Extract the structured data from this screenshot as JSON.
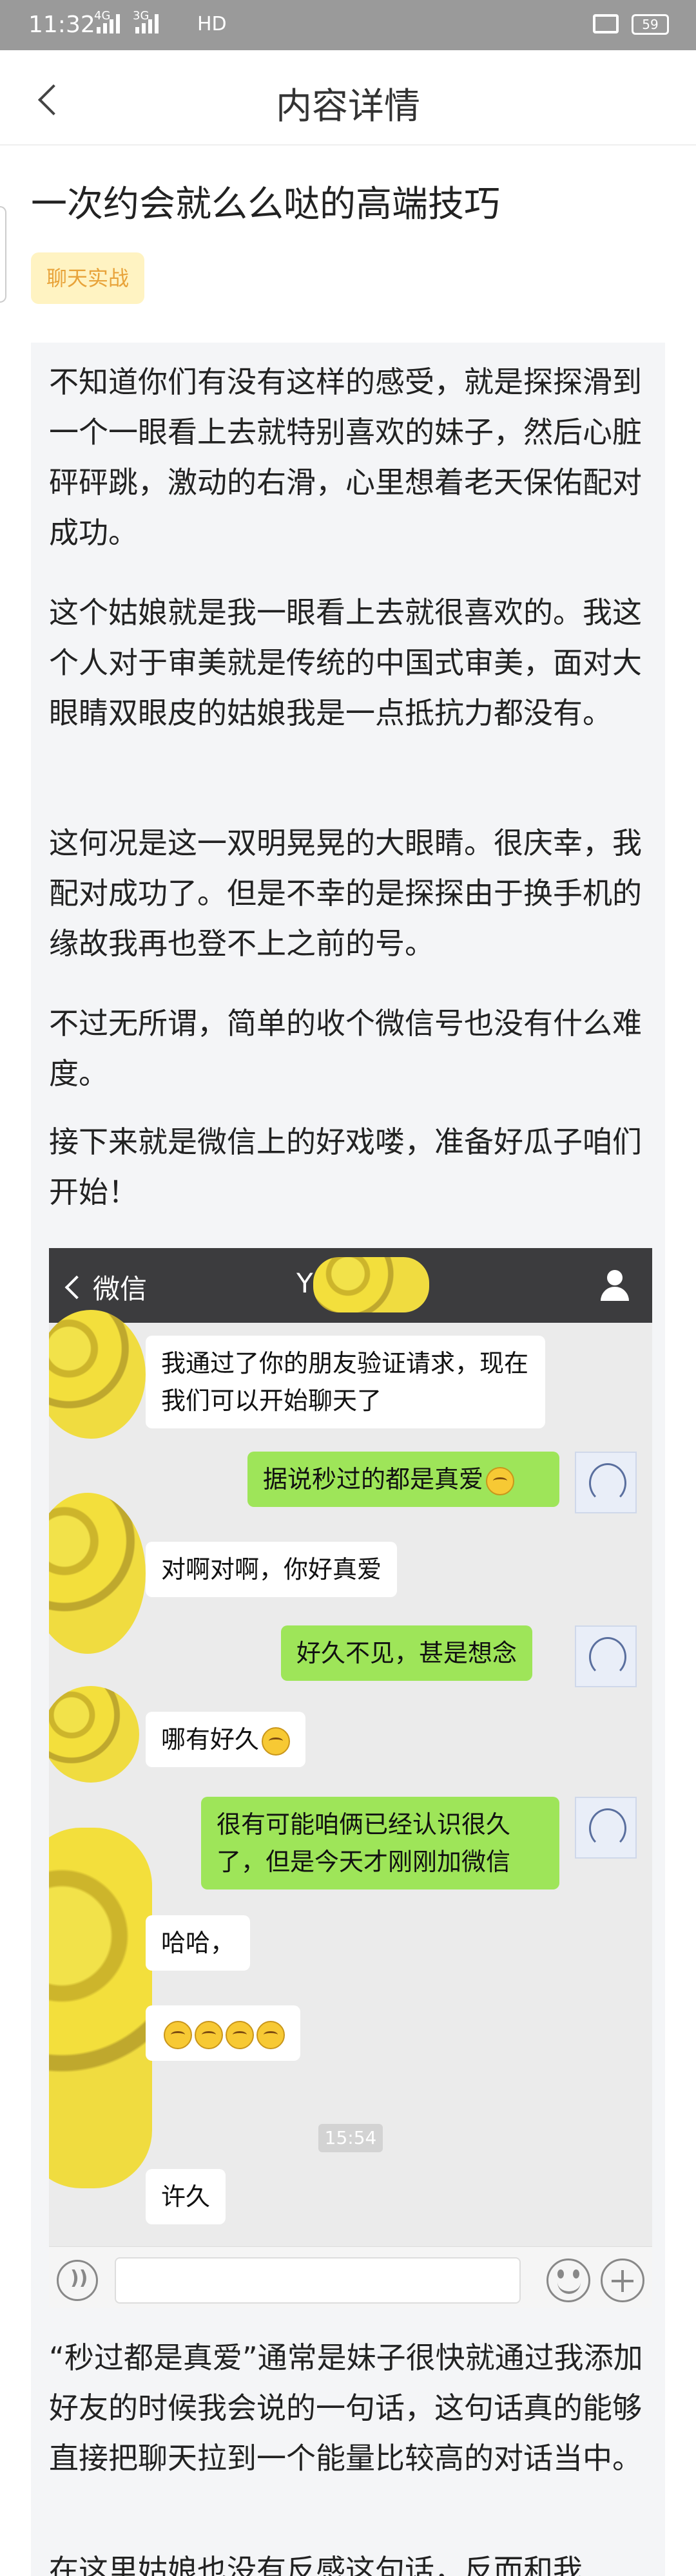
{
  "status_bar": {
    "time": "11:32",
    "network_1": "4G",
    "network_2": "3G",
    "hd": "HD",
    "battery": "59"
  },
  "header": {
    "title": "内容详情"
  },
  "article": {
    "title": "一次约会就么么哒的高端技巧",
    "tag": "聊天实战",
    "paragraphs": [
      "不知道你们有没有这样的感受，就是探探滑到一个一眼看上去就特别喜欢的妹子，然后心脏砰砰跳，激动的右滑，心里想着老天保佑配对成功。",
      "这个姑娘就是我一眼看上去就很喜欢的。我这个人对于审美就是传统的中国式审美，面对大眼睛双眼皮的姑娘我是一点抵抗力都没有。",
      "这何况是这一双明晃晃的大眼睛。很庆幸，我配对成功了。但是不幸的是探探由于换手机的缘故我再也登不上之前的号。",
      "不过无所谓，简单的收个微信号也没有什么难度。",
      "接下来就是微信上的好戏喽，准备好瓜子咱们开始！",
      "“秒过都是真爱”通常是妹子很快就通过我添加好友的时候我会说的一句话，这句话真的能够直接把聊天拉到一个能量比较高的对话当中。",
      "在这里姑娘也没有反感这句话，反而和我"
    ]
  },
  "chat": {
    "back_label": "微信",
    "contact_name": "Y",
    "time_divider": "15:54",
    "messages": [
      {
        "side": "left",
        "text": "我通过了你的朋友验证请求，现在我们可以开始聊天了"
      },
      {
        "side": "right",
        "text": "据说秒过的都是真爱"
      },
      {
        "side": "left",
        "text": "对啊对啊，你好真爱"
      },
      {
        "side": "right",
        "text": "好久不见，甚是想念"
      },
      {
        "side": "left",
        "text": "哪有好久"
      },
      {
        "side": "right",
        "text": "很有可能咱俩已经认识很久了，但是今天才刚刚加微信"
      },
      {
        "side": "left",
        "text": "哈哈，"
      },
      {
        "side": "left",
        "text": ""
      },
      {
        "side": "left",
        "text": "许久"
      }
    ]
  }
}
